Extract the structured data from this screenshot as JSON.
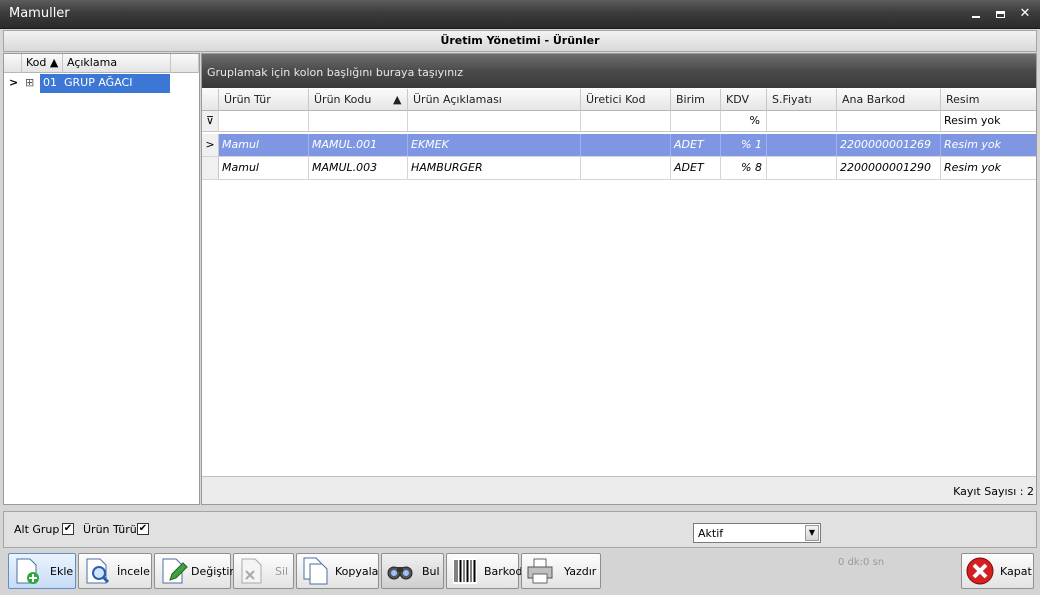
{
  "window": {
    "title": "Mamuller",
    "minimize": "▬",
    "maximize": "▭",
    "close": "✕"
  },
  "panel_title": "Üretim Yönetimi - Ürünler",
  "left_grid": {
    "columns": [
      "Kod",
      "Açıklama"
    ],
    "sort_glyph": "▲",
    "rows": [
      {
        "indicator": ">",
        "expand": "⊞",
        "kod": "01",
        "aciklama": "GRUP AĞACI"
      }
    ]
  },
  "group_panel_text": "Gruplamak için kolon başlığını buraya taşıyınız",
  "grid": {
    "columns": [
      "Ürün Tür",
      "Ürün Kodu",
      "Ürün Açıklaması",
      "Üretici Kod",
      "Birim",
      "KDV",
      "S.Fiyatı",
      "Ana Barkod",
      "Resim"
    ],
    "sort_glyph": "▲",
    "filter": {
      "icon": "⊽",
      "kdv": "%",
      "resim": "Resim yok"
    },
    "rows": [
      {
        "indicator": ">",
        "tur": "Mamul",
        "kod": "MAMUL.001",
        "aciklama": "EKMEK",
        "uretici": "",
        "birim": "ADET",
        "kdv": "% 1",
        "fiyat": "",
        "barkod": "2200000001269",
        "resim": "Resim yok",
        "selected": true
      },
      {
        "indicator": "",
        "tur": "Mamul",
        "kod": "MAMUL.003",
        "aciklama": "HAMBURGER",
        "uretici": "",
        "birim": "ADET",
        "kdv": "% 8",
        "fiyat": "",
        "barkod": "2200000001290",
        "resim": "Resim yok",
        "selected": false
      }
    ],
    "record_count": "Kayıt Sayısı : 2"
  },
  "options": {
    "alt_grup_label": "Alt Grup",
    "alt_grup_checked": "✔",
    "urun_turu_label": "Ürün Türü",
    "urun_turu_checked": "✔",
    "status_value": "Aktif",
    "status_arrow": "▼"
  },
  "toolbar": {
    "ekle": "Ekle",
    "incele": "İncele",
    "degistir": "Değiştir",
    "sil": "Sil",
    "kopyala": "Kopyala",
    "bul": "Bul",
    "barkod": "Barkod",
    "yazdir": "Yazdır",
    "timer": "0 dk:0 sn",
    "kapat": "Kapat"
  }
}
